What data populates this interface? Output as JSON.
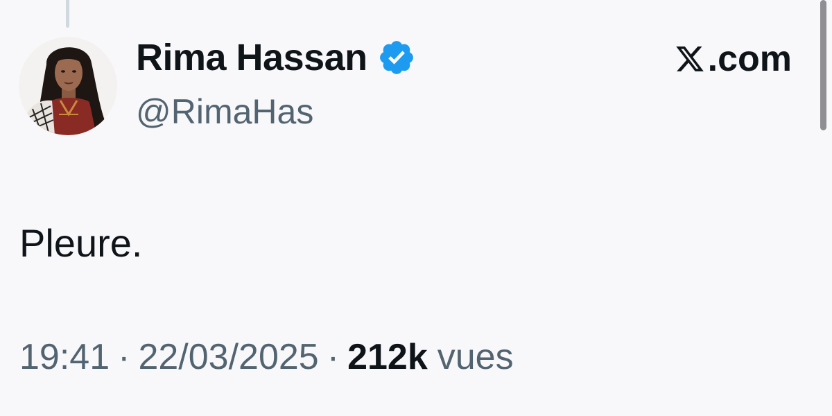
{
  "author": {
    "display_name": "Rima Hassan",
    "handle": "@RimaHas",
    "verified": true,
    "verified_icon": "verified-badge-icon",
    "avatar_icon": "profile-photo"
  },
  "source": {
    "site": ".com",
    "logo_icon": "x-logo-icon"
  },
  "tweet": {
    "text": "Pleure.",
    "time": "19:41",
    "date": "22/03/2025",
    "separator": "·",
    "views_count": "212k",
    "views_label": "vues"
  },
  "colors": {
    "verified_blue": "#1d9bf0",
    "text_primary": "#0f1419",
    "text_secondary": "#536471",
    "background": "#f8f8fa"
  }
}
